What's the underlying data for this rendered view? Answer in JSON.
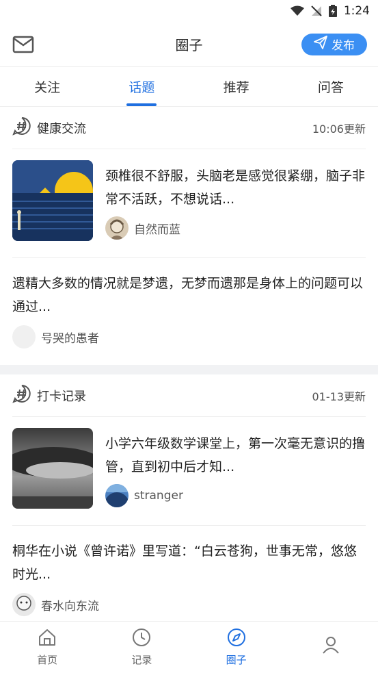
{
  "status": {
    "time": "1:24"
  },
  "header": {
    "title": "圈子",
    "publish_label": "发布"
  },
  "tabs": [
    {
      "label": "关注"
    },
    {
      "label": "话题"
    },
    {
      "label": "推荐"
    },
    {
      "label": "问答"
    }
  ],
  "sections": [
    {
      "title": "健康交流",
      "updated": "10:06更新",
      "image_post": {
        "text": "颈椎很不舒服，头脑老是感觉很紧绷，脑子非常不活跃，不想说话...",
        "author": "自然而蓝"
      },
      "text_post": {
        "text": "遗精大多数的情况就是梦遗，无梦而遗那是身体上的问题可以通过...",
        "author": "号哭的愚者"
      }
    },
    {
      "title": "打卡记录",
      "updated": "01-13更新",
      "image_post": {
        "text": "小学六年级数学课堂上，第一次毫无意识的撸管，直到初中后才知...",
        "author": "stranger"
      },
      "text_post": {
        "text": "桐华在小说《曾许诺》里写道：“白云苍狗，世事无常，悠悠时光...",
        "author": "春水向东流"
      }
    }
  ],
  "tabbar": [
    {
      "label": "首页"
    },
    {
      "label": "记录"
    },
    {
      "label": "圈子"
    },
    {
      "label": ""
    }
  ],
  "colors": {
    "accent": "#1f6fe0",
    "publish_bg": "#3b8ff3"
  }
}
